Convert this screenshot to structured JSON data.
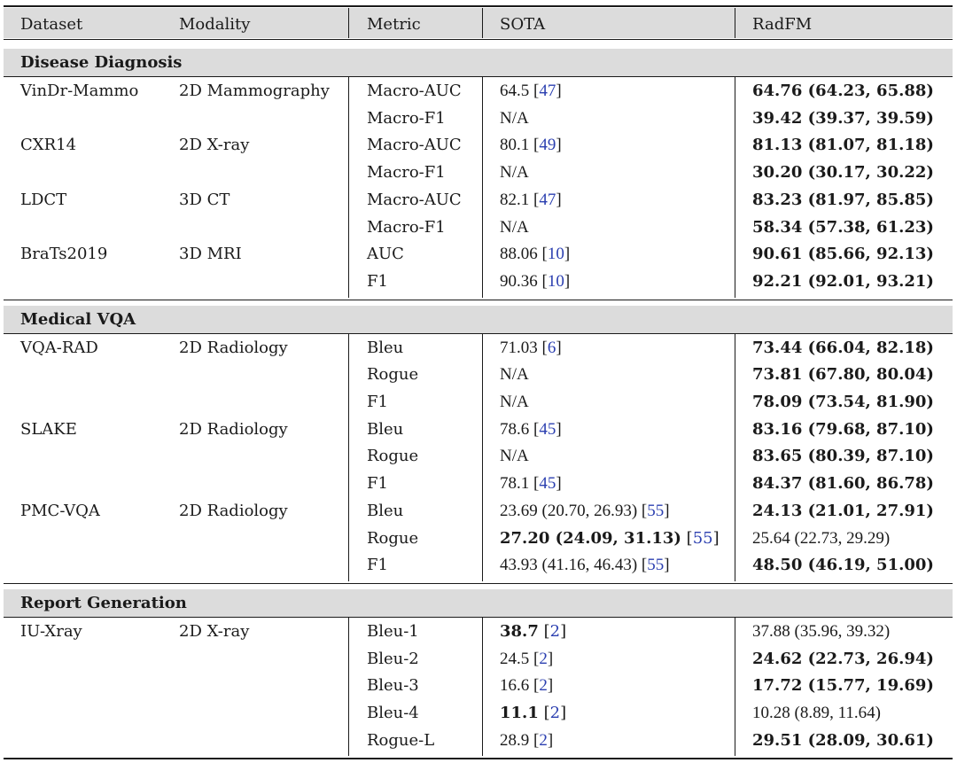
{
  "header": {
    "columns": [
      "Dataset",
      "Modality",
      "Metric",
      "SOTA",
      "RadFM"
    ]
  },
  "sections": [
    {
      "title": "Disease Diagnosis",
      "rows": [
        {
          "dataset": "VinDr-Mammo",
          "modality": "2D Mammography",
          "metric": "Macro-AUC",
          "sota": "64.5",
          "sota_ref": "47",
          "sota_bold": false,
          "radfm": "64.76 (64.23, 65.88)",
          "radfm_bold": true
        },
        {
          "dataset": "",
          "modality": "",
          "metric": "Macro-F1",
          "sota": "N/A",
          "sota_ref": "",
          "sota_bold": false,
          "radfm": "39.42 (39.37, 39.59)",
          "radfm_bold": true
        },
        {
          "dataset": "CXR14",
          "modality": "2D X-ray",
          "metric": "Macro-AUC",
          "sota": "80.1",
          "sota_ref": "49",
          "sota_bold": false,
          "radfm": "81.13 (81.07, 81.18)",
          "radfm_bold": true
        },
        {
          "dataset": "",
          "modality": "",
          "metric": "Macro-F1",
          "sota": "N/A",
          "sota_ref": "",
          "sota_bold": false,
          "radfm": "30.20 (30.17, 30.22)",
          "radfm_bold": true
        },
        {
          "dataset": "LDCT",
          "modality": "3D CT",
          "metric": "Macro-AUC",
          "sota": "82.1",
          "sota_ref": "47",
          "sota_bold": false,
          "radfm": "83.23 (81.97, 85.85)",
          "radfm_bold": true
        },
        {
          "dataset": "",
          "modality": "",
          "metric": "Macro-F1",
          "sota": "N/A",
          "sota_ref": "",
          "sota_bold": false,
          "radfm": "58.34 (57.38, 61.23)",
          "radfm_bold": true
        },
        {
          "dataset": "BraTs2019",
          "modality": "3D MRI",
          "metric": "AUC",
          "sota": "88.06",
          "sota_ref": "10",
          "sota_bold": false,
          "radfm": "90.61 (85.66, 92.13)",
          "radfm_bold": true
        },
        {
          "dataset": "",
          "modality": "",
          "metric": "F1",
          "sota": "90.36",
          "sota_ref": "10",
          "sota_bold": false,
          "radfm": "92.21 (92.01, 93.21)",
          "radfm_bold": true
        }
      ]
    },
    {
      "title": "Medical VQA",
      "rows": [
        {
          "dataset": "VQA-RAD",
          "modality": "2D Radiology",
          "metric": "Bleu",
          "sota": "71.03",
          "sota_ref": "6",
          "sota_bold": false,
          "radfm": "73.44 (66.04, 82.18)",
          "radfm_bold": true
        },
        {
          "dataset": "",
          "modality": "",
          "metric": "Rogue",
          "sota": "N/A",
          "sota_ref": "",
          "sota_bold": false,
          "radfm": "73.81 (67.80, 80.04)",
          "radfm_bold": true
        },
        {
          "dataset": "",
          "modality": "",
          "metric": "F1",
          "sota": "N/A",
          "sota_ref": "",
          "sota_bold": false,
          "radfm": "78.09 (73.54, 81.90)",
          "radfm_bold": true
        },
        {
          "dataset": "SLAKE",
          "modality": "2D Radiology",
          "metric": "Bleu",
          "sota": "78.6",
          "sota_ref": "45",
          "sota_bold": false,
          "radfm": "83.16 (79.68, 87.10)",
          "radfm_bold": true
        },
        {
          "dataset": "",
          "modality": "",
          "metric": "Rogue",
          "sota": "N/A",
          "sota_ref": "",
          "sota_bold": false,
          "radfm": "83.65 (80.39, 87.10)",
          "radfm_bold": true
        },
        {
          "dataset": "",
          "modality": "",
          "metric": "F1",
          "sota": "78.1",
          "sota_ref": "45",
          "sota_bold": false,
          "radfm": "84.37 (81.60, 86.78)",
          "radfm_bold": true
        },
        {
          "dataset": "PMC-VQA",
          "modality": "2D Radiology",
          "metric": "Bleu",
          "sota": "23.69 (20.70, 26.93)",
          "sota_ref": "55",
          "sota_bold": false,
          "radfm": "24.13 (21.01, 27.91)",
          "radfm_bold": true
        },
        {
          "dataset": "",
          "modality": "",
          "metric": "Rogue",
          "sota": "27.20 (24.09, 31.13)",
          "sota_ref": "55",
          "sota_bold": true,
          "radfm": "25.64 (22.73, 29.29)",
          "radfm_bold": false
        },
        {
          "dataset": "",
          "modality": "",
          "metric": "F1",
          "sota": "43.93 (41.16, 46.43)",
          "sota_ref": "55",
          "sota_bold": false,
          "radfm": "48.50 (46.19, 51.00)",
          "radfm_bold": true
        }
      ]
    },
    {
      "title": "Report Generation",
      "rows": [
        {
          "dataset": "IU-Xray",
          "modality": "2D X-ray",
          "metric": "Bleu-1",
          "sota": "38.7",
          "sota_ref": "2",
          "sota_bold": true,
          "radfm": "37.88 (35.96, 39.32)",
          "radfm_bold": false
        },
        {
          "dataset": "",
          "modality": "",
          "metric": "Bleu-2",
          "sota": "24.5",
          "sota_ref": "2",
          "sota_bold": false,
          "radfm": "24.62 (22.73, 26.94)",
          "radfm_bold": true
        },
        {
          "dataset": "",
          "modality": "",
          "metric": "Bleu-3",
          "sota": "16.6",
          "sota_ref": "2",
          "sota_bold": false,
          "radfm": "17.72 (15.77, 19.69)",
          "radfm_bold": true
        },
        {
          "dataset": "",
          "modality": "",
          "metric": "Bleu-4",
          "sota": "11.1",
          "sota_ref": "2",
          "sota_bold": true,
          "radfm": "10.28 (8.89, 11.64)",
          "radfm_bold": false
        },
        {
          "dataset": "",
          "modality": "",
          "metric": "Rogue-L",
          "sota": "28.9",
          "sota_ref": "2",
          "sota_bold": false,
          "radfm": "29.51 (28.09, 30.61)",
          "radfm_bold": true
        }
      ]
    }
  ]
}
